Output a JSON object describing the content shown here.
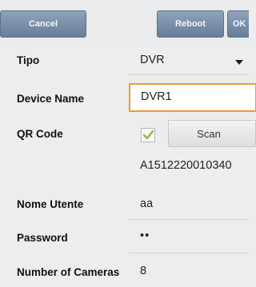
{
  "toolbar": {
    "cancel_label": "Cancel",
    "reboot_label": "Reboot",
    "ok_label": "OK"
  },
  "form": {
    "tipo": {
      "label": "Tipo",
      "value": "DVR"
    },
    "device_name": {
      "label": "Device Name",
      "value": "DVR1"
    },
    "qr_code": {
      "label": "QR Code",
      "checked": true,
      "scan_label": "Scan"
    },
    "serial": {
      "value": "A1512220010340"
    },
    "user": {
      "label": "Nome Utente",
      "value": "aa"
    },
    "password": {
      "label": "Password",
      "value": "••"
    },
    "cameras": {
      "label": "Number of Cameras",
      "value": "8"
    }
  },
  "colors": {
    "toolbar_button": "#7a8ea8",
    "focus_border": "#f29a2e",
    "checkmark": "#8bc34a"
  }
}
